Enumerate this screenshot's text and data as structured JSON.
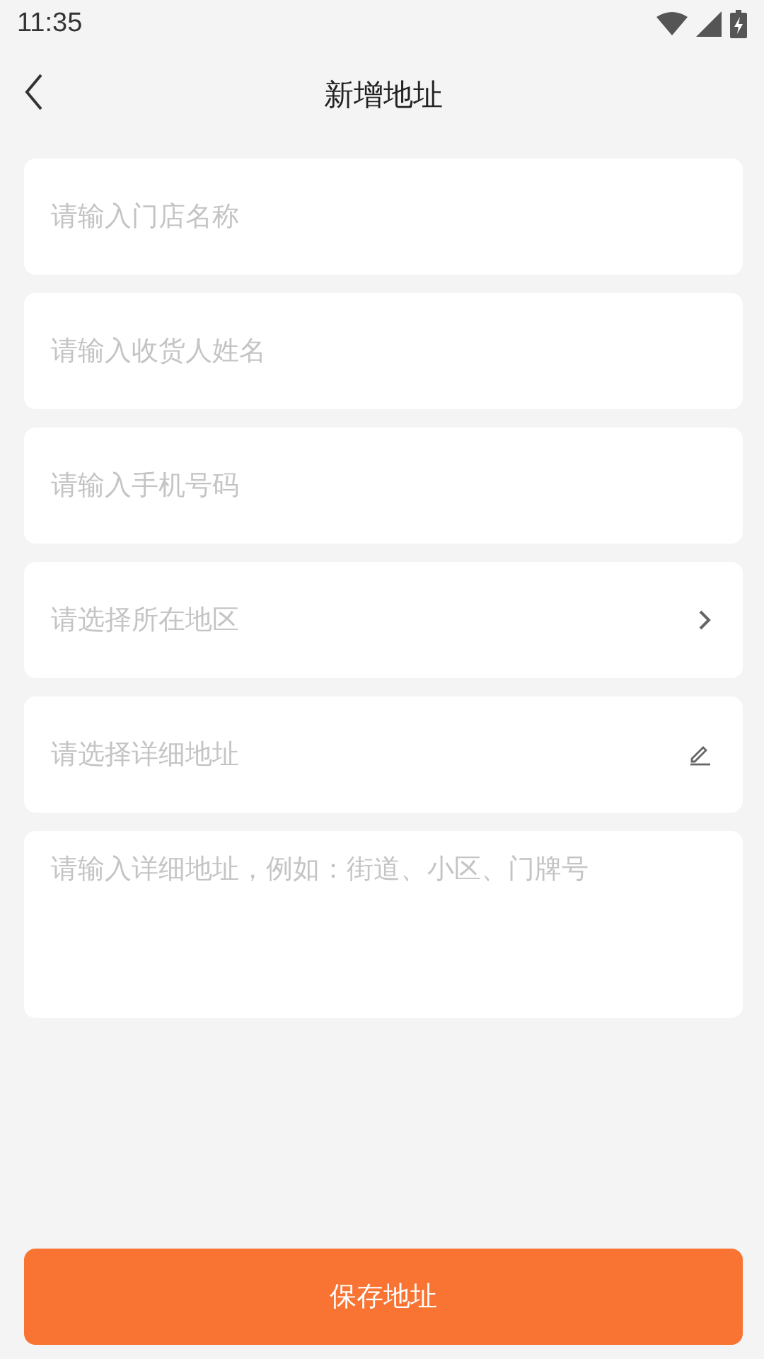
{
  "status_bar": {
    "time": "11:35"
  },
  "header": {
    "title": "新增地址"
  },
  "fields": [
    {
      "kind": "input",
      "placeholder": "请输入门店名称"
    },
    {
      "kind": "input",
      "placeholder": "请输入收货人姓名"
    },
    {
      "kind": "input",
      "placeholder": "请输入手机号码"
    },
    {
      "kind": "select",
      "placeholder": "请选择所在地区"
    },
    {
      "kind": "edit",
      "placeholder": "请选择详细地址"
    },
    {
      "kind": "textarea",
      "placeholder": "请输入详细地址，例如：街道、小区、门牌号"
    }
  ],
  "save_button": {
    "label": "保存地址"
  }
}
